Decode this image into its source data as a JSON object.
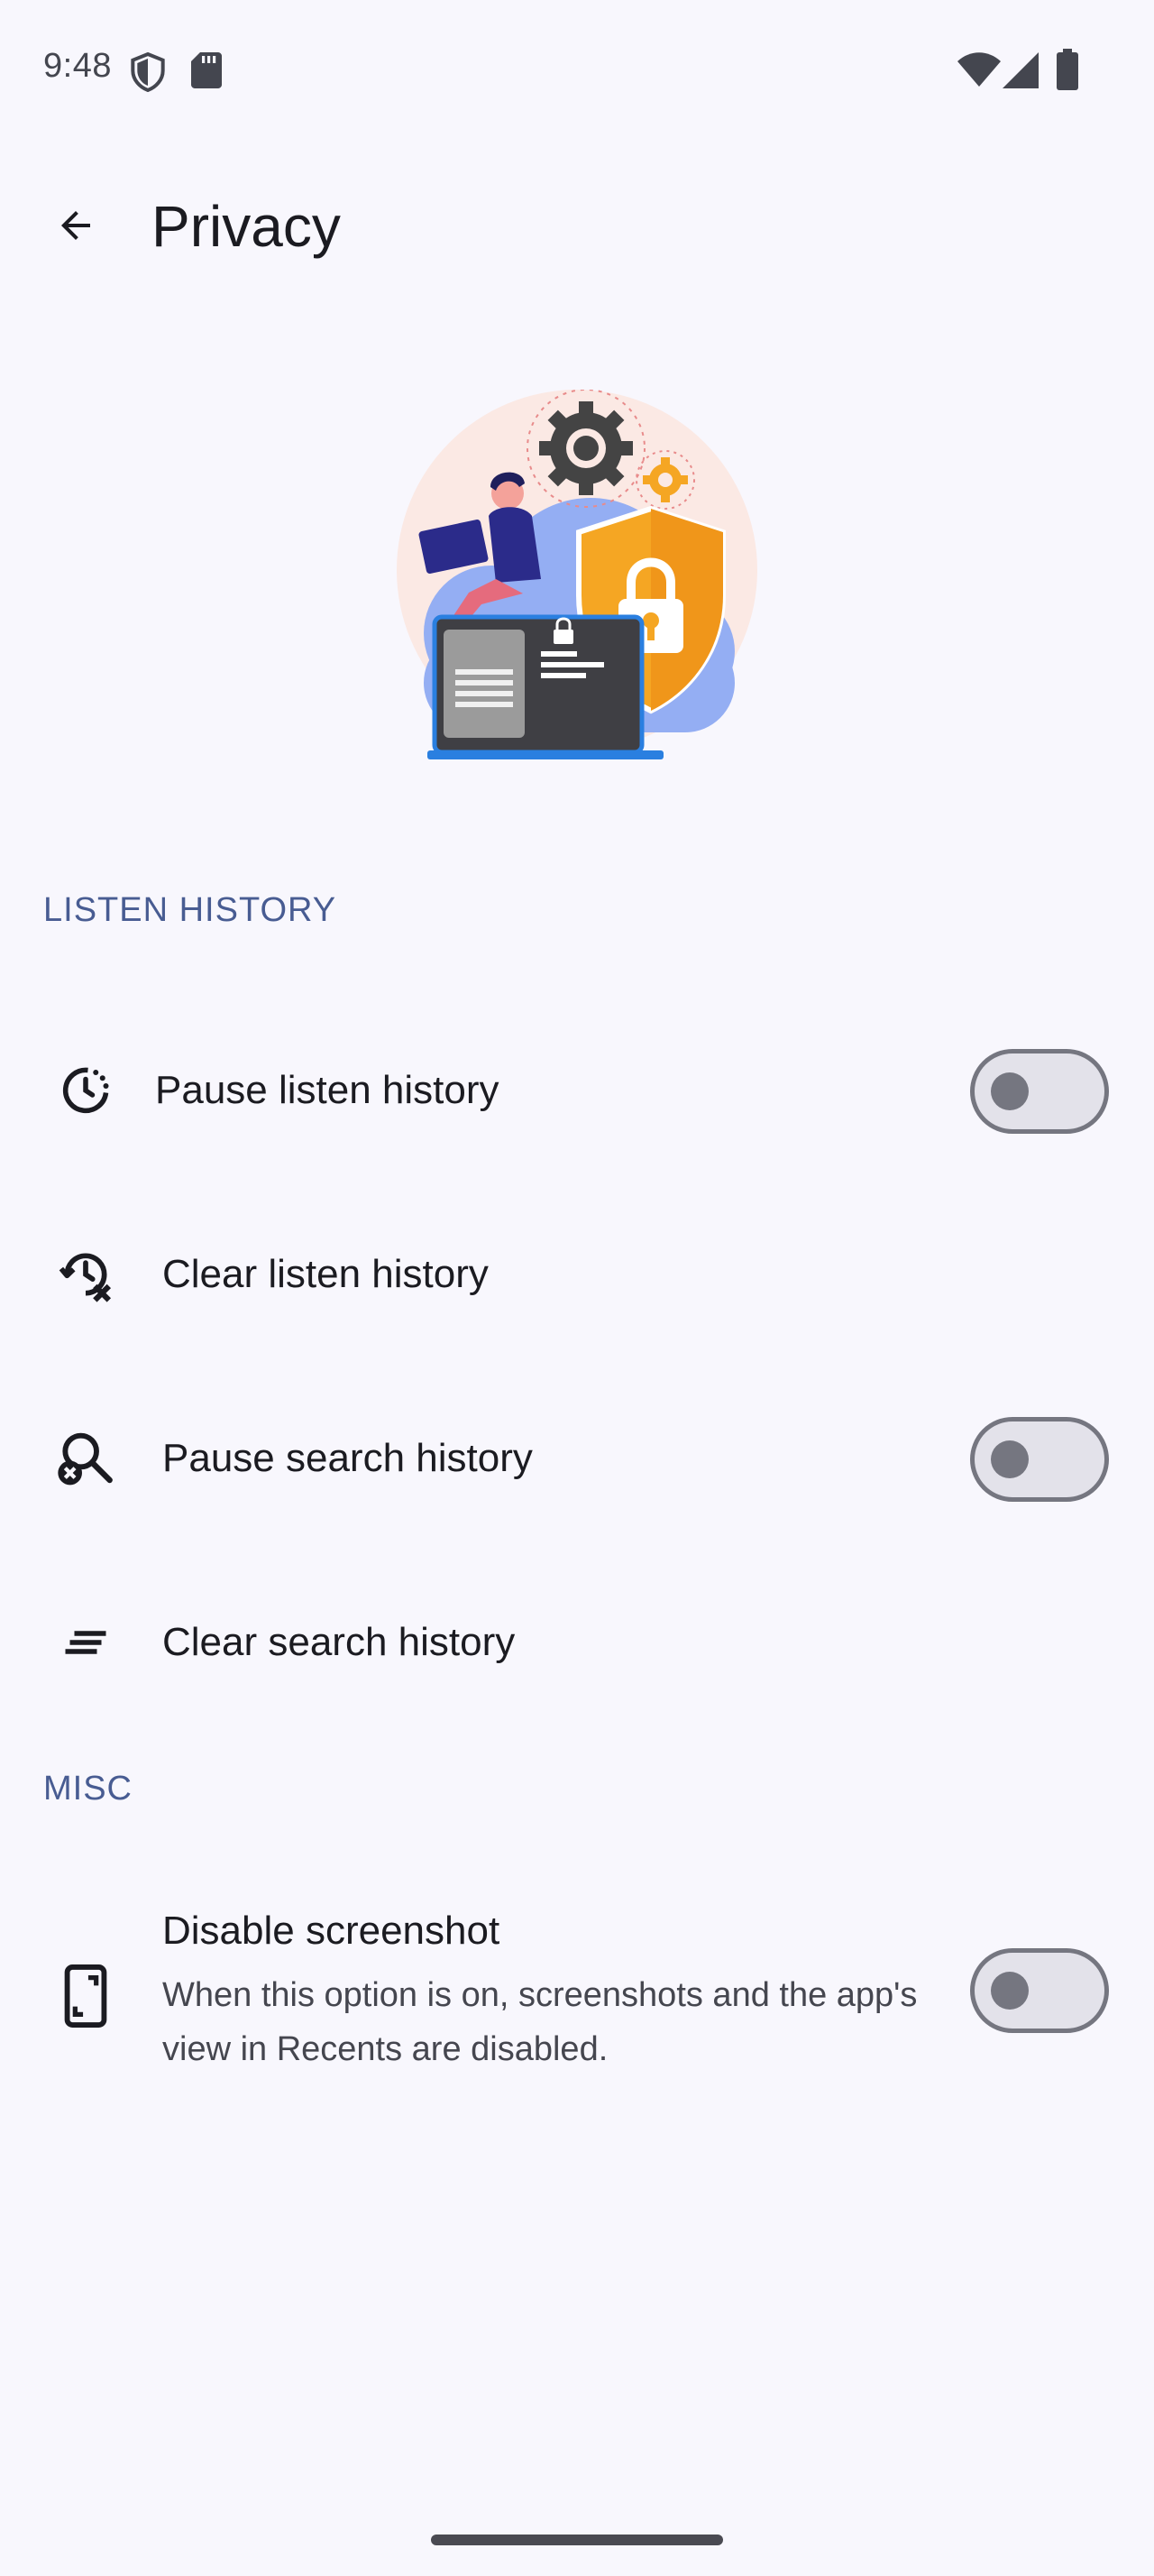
{
  "status_bar": {
    "time": "9:48",
    "icons": [
      "shield-icon",
      "sd-card-icon",
      "wifi-icon",
      "cellular-signal-icon",
      "battery-icon"
    ]
  },
  "app_bar": {
    "back_icon": "arrow-back-icon",
    "title": "Privacy"
  },
  "illustration": {
    "description_icon": "privacy-illustration"
  },
  "sections": [
    {
      "header": "LISTEN HISTORY",
      "items": [
        {
          "icon": "pause-history-icon",
          "title": "Pause listen history",
          "has_switch": true,
          "switch_on": false
        },
        {
          "icon": "clear-history-icon",
          "title": "Clear listen history",
          "has_switch": false
        },
        {
          "icon": "search-off-icon",
          "title": "Pause search history",
          "has_switch": true,
          "switch_on": false
        },
        {
          "icon": "clear-all-icon",
          "title": "Clear search history",
          "has_switch": false
        }
      ]
    },
    {
      "header": "MISC",
      "items": [
        {
          "icon": "phone-screenshot-icon",
          "title": "Disable screenshot",
          "summary": "When this option is on, screenshots and the app's view in Recents are disabled.",
          "has_switch": true,
          "switch_on": false
        }
      ]
    }
  ],
  "colors": {
    "background": "#f8f7fd",
    "section_header": "#485c92",
    "switch_outline": "#757680",
    "switch_track": "#e3e2ea",
    "shield": "#f5a623",
    "cloud": "#8fa8ef"
  }
}
